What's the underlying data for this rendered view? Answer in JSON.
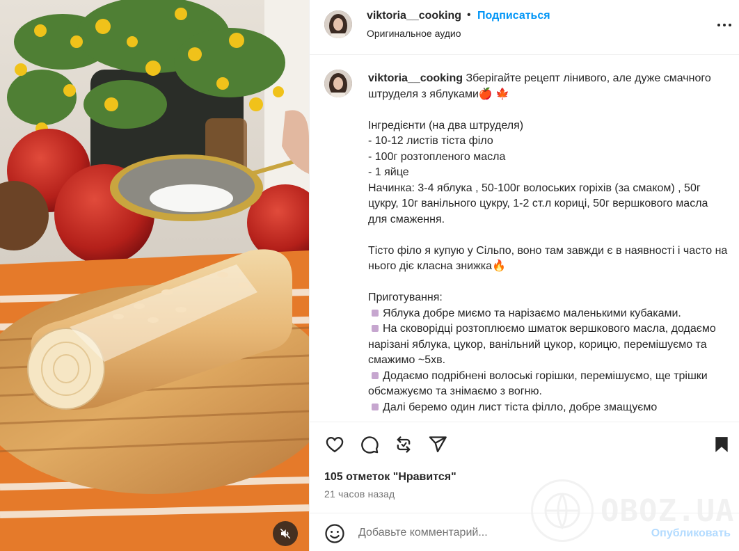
{
  "post": {
    "media_alt": "strudel with powdered sugar",
    "mute_icon": "speaker-muted-icon"
  },
  "header": {
    "username": "viktoria__cooking",
    "separator": "•",
    "follow_label": "Подписаться",
    "audio": "Оригинальное аудио",
    "more_icon": "more-horizontal-icon"
  },
  "caption": {
    "username": "viktoria__cooking",
    "intro": "Зберігайте рецепт лінивого, але дуже смачного штруделя з яблуками🍎 🍁",
    "ingredients_title": "Інгредієнти (на два штруделя)",
    "ingredient_1": "- 10-12 листів тіста філо",
    "ingredient_2": "- 100г розтопленого масла",
    "ingredient_3": "- 1 яйце",
    "filling": "Начинка: 3-4 яблука , 50-100г волоських горіхів (за смаком) , 50г цукру, 10г ванільного цукру, 1-2 ст.л кориці, 50г вершкового масла для смаження.",
    "phyllo_note": "Тісто філо я купую у Сільпо, воно там завжди є в наявності і часто на нього діє класна знижка🔥",
    "prep_title": "Приготування:",
    "step_1": "Яблука добре миємо та нарізаємо маленькими кубаками.",
    "step_2": "На сковорідці розтоплюємо шматок вершкового масла, додаємо нарізані яблука, цукор, ванільний цукор, корицю, перемішуємо та смажимо ~5хв.",
    "step_3": "Додаємо подрібнені волоські горішки, перемішуємо, ще трішки обсмажуємо та знімаємо з вогню.",
    "step_4": "Далі беремо один лист тіста філло, добре змащуємо"
  },
  "actions": {
    "icons": [
      "heart-icon",
      "comment-icon",
      "repost-icon",
      "share-icon",
      "bookmark-icon"
    ],
    "likes": "105 отметок \"Нравится\"",
    "time": "21 часов назад"
  },
  "watermark": {
    "text": "OBOZ.UA"
  },
  "comment": {
    "placeholder": "Добавьте комментарий...",
    "publish_label": "Опубликовать"
  }
}
